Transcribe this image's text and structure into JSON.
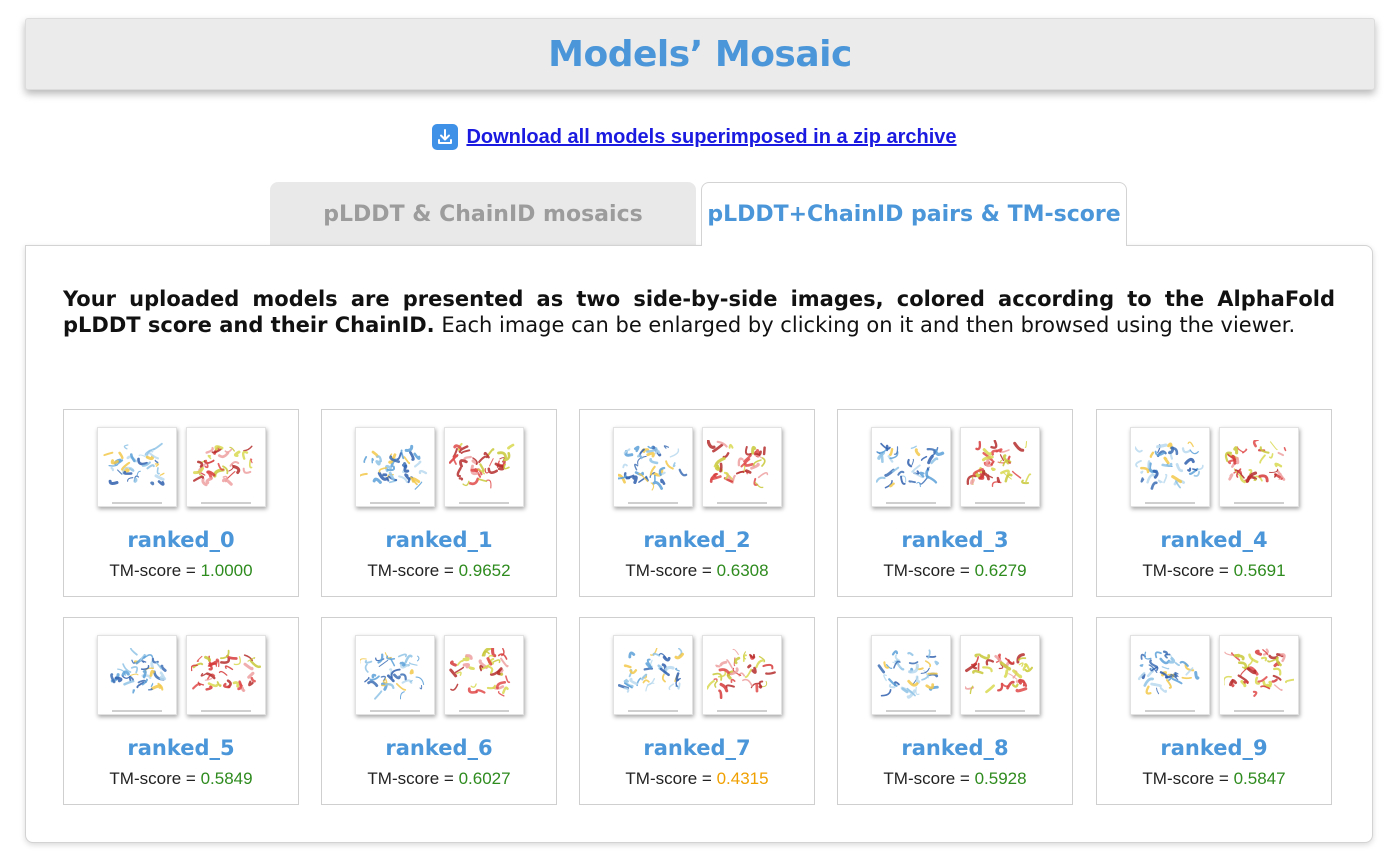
{
  "header": {
    "title": "Models’ Mosaic"
  },
  "download": {
    "icon": "download-icon",
    "link_text": "Download all models superimposed in a zip archive"
  },
  "tabs": [
    {
      "label": "pLDDT & ChainID mosaics",
      "active": false
    },
    {
      "label": "pLDDT+ChainID pairs & TM-score",
      "active": true
    }
  ],
  "intro": {
    "bold": "Your uploaded models are presented as two side-by-side images, colored according to the AlphaFold pLDDT score and their ChainID.",
    "rest": " Each image can be enlarged by clicking on it and then browsed using the viewer."
  },
  "score_label": "TM-score = ",
  "colors": {
    "accent": "#4a96d9",
    "good": "#2e8b1e",
    "mid": "#f0a000"
  },
  "models": [
    {
      "name": "ranked_0",
      "tm": "1.0000",
      "level": "good"
    },
    {
      "name": "ranked_1",
      "tm": "0.9652",
      "level": "good"
    },
    {
      "name": "ranked_2",
      "tm": "0.6308",
      "level": "good"
    },
    {
      "name": "ranked_3",
      "tm": "0.6279",
      "level": "good"
    },
    {
      "name": "ranked_4",
      "tm": "0.5691",
      "level": "good"
    },
    {
      "name": "ranked_5",
      "tm": "0.5849",
      "level": "good"
    },
    {
      "name": "ranked_6",
      "tm": "0.6027",
      "level": "good"
    },
    {
      "name": "ranked_7",
      "tm": "0.4315",
      "level": "mid"
    },
    {
      "name": "ranked_8",
      "tm": "0.5928",
      "level": "good"
    },
    {
      "name": "ranked_9",
      "tm": "0.5847",
      "level": "good"
    }
  ]
}
